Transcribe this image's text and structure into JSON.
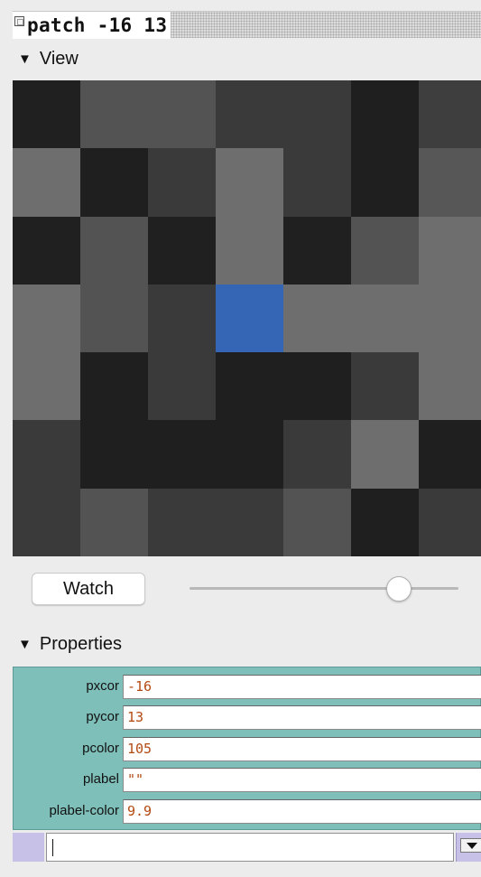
{
  "window": {
    "title": "patch -16 13"
  },
  "view_section": {
    "label": "View",
    "grid_rows": [
      [
        "#202020",
        "#535353",
        "#535353",
        "#3a3a3a",
        "#3a3a3a",
        "#1f1f1f",
        "#3e3e3e",
        "#3e3e3e"
      ],
      [
        "#6e6e6e",
        "#1f1f1f",
        "#3a3a3a",
        "#6e6e6e",
        "#3a3a3a",
        "#1f1f1f",
        "#575757",
        "#575757"
      ],
      [
        "#202020",
        "#535353",
        "#202020",
        "#6e6e6e",
        "#202020",
        "#535353",
        "#6e6e6e",
        "#6e6e6e"
      ],
      [
        "#6e6e6e",
        "#535353",
        "#3a3a3a",
        "#3565b5",
        "#6e6e6e",
        "#6e6e6e",
        "#6e6e6e",
        "#6e6e6e"
      ],
      [
        "#6e6e6e",
        "#1f1f1f",
        "#3a3a3a",
        "#1f1f1f",
        "#1f1f1f",
        "#3a3a3a",
        "#6e6e6e",
        "#6e6e6e"
      ],
      [
        "#3a3a3a",
        "#1f1f1f",
        "#1f1f1f",
        "#1f1f1f",
        "#3a3a3a",
        "#6e6e6e",
        "#1f1f1f",
        "#1f1f1f"
      ],
      [
        "#3a3a3a",
        "#535353",
        "#3a3a3a",
        "#3a3a3a",
        "#535353",
        "#1f1f1f",
        "#3a3a3a",
        "#3a3a3a"
      ]
    ]
  },
  "watch": {
    "button_label": "Watch",
    "zoom_slider_value": 0.78
  },
  "properties_section": {
    "label": "Properties",
    "rows": [
      {
        "label": "pxcor",
        "value": "-16"
      },
      {
        "label": "pycor",
        "value": "13"
      },
      {
        "label": "pcolor",
        "value": "105"
      },
      {
        "label": "plabel",
        "value": "\"\""
      },
      {
        "label": "plabel-color",
        "value": "9.9"
      }
    ]
  },
  "command_line": {
    "value": ""
  }
}
